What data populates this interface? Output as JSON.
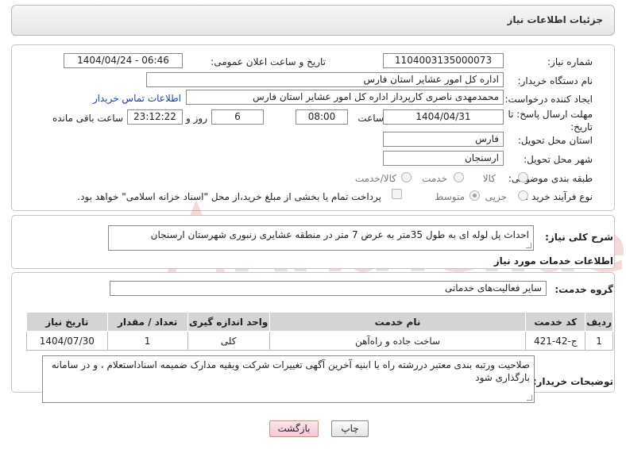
{
  "header": {
    "title": "جزئیات اطلاعات نیاز"
  },
  "form": {
    "need_number_label": "شماره نیاز:",
    "need_number": "1104003135000073",
    "announce_label": "تاریخ و ساعت اعلان عمومی:",
    "announce_value": "1404/04/24 - 06:46",
    "buyer_org_label": "نام دستگاه خریدار:",
    "buyer_org": "اداره کل امور عشایر استان فارس",
    "creator_label": "ایجاد کننده درخواست:",
    "creator": "محمدمهدی ناصری کارپرداز اداره کل امور عشایر استان فارس",
    "contact_link": "اطلاعات تماس خریدار",
    "deadline_label": "مهلت ارسال پاسخ: تا تاریخ:",
    "deadline_date": "1404/04/31",
    "time_label": "ساعت",
    "deadline_time": "08:00",
    "days_value": "6",
    "days_label": "روز و",
    "remaining_time": "23:12:22",
    "remaining_label": "ساعت باقی مانده",
    "province_label": "استان محل تحویل:",
    "province": "فارس",
    "city_label": "شهر محل تحویل:",
    "city": "ارسنجان",
    "category_label": "طبقه بندی موضوعی:",
    "category_options": [
      "کالا",
      "خدمت",
      "کالا/خدمت"
    ],
    "process_label": "نوع فرآیند خرید :",
    "process_options": [
      "جزیی",
      "متوسط"
    ],
    "payment_note": "پرداخت تمام یا بخشی از مبلغ خرید،از محل \"اسناد خزانه اسلامی\" خواهد بود."
  },
  "description": {
    "label": "شرح کلی نیاز:",
    "text": "احداث پل لوله ای به طول 35متر به  عرض 7 متر در منطقه عشایری زنبوری شهرستان ارسنجان"
  },
  "services": {
    "section_title": "اطلاعات خدمات مورد نیاز",
    "group_label": "گروه خدمت:",
    "group_value": "سایر فعالیت‌های خدماتی",
    "columns": [
      "ردیف",
      "کد خدمت",
      "نام خدمت",
      "واحد اندازه گیری",
      "تعداد / مقدار",
      "تاریخ نیاز"
    ],
    "rows": [
      [
        "1",
        "ج-42-421",
        "ساخت جاده و راه‌آهن",
        "کلی",
        "1",
        "1404/07/30"
      ]
    ]
  },
  "buyer_notes": {
    "label": "توضیحات خریدار:",
    "text": "صلاحیت ورتبه بندی معتبر دررشته  راه یا ابنیه آخرین آگهی تغییرات شرکت   وبقیه مدارک  ضمیمه اسناداستعلام ، و در سامانه بارگذاری شود"
  },
  "buttons": {
    "print": "چاپ",
    "back": "بازگشت"
  },
  "watermark_text": "AriaTender.neT",
  "colors": {
    "link": "#1c3fa6",
    "watermark": "#c0392b"
  }
}
